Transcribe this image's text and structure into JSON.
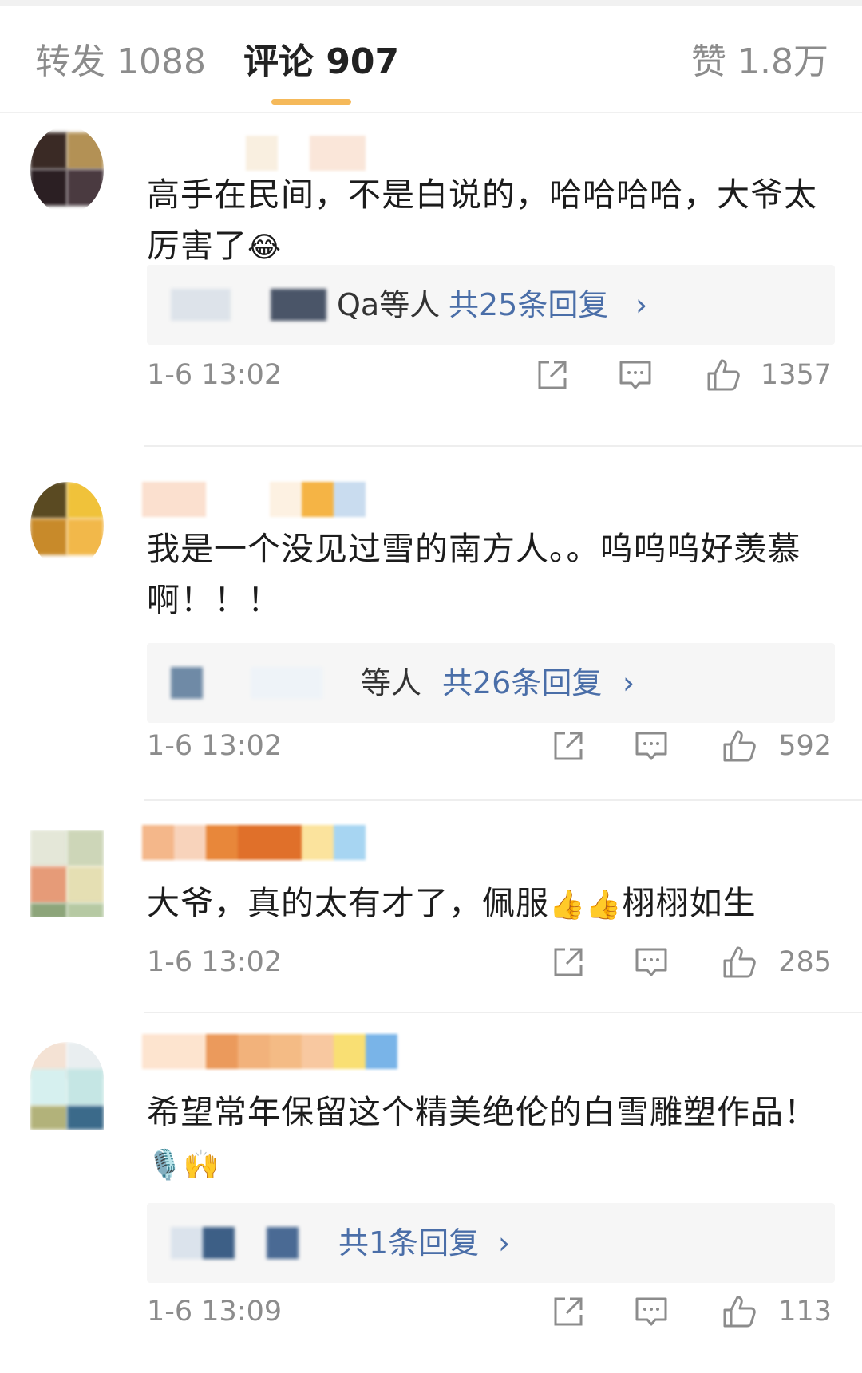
{
  "tabs": {
    "repost": "转发 1088",
    "comments": "评论 907",
    "likes": "赞 1.8万"
  },
  "comments": [
    {
      "text": "高手在民间，不是白说的，哈哈哈哈，大爷太厉害了",
      "emoji": "😂",
      "reply_who": "Qa等人",
      "reply_count": "共25条回复",
      "time": "1-6 13:02",
      "likes": "1357"
    },
    {
      "text": "我是一个没见过雪的南方人。。呜呜呜好羡慕啊！！！",
      "reply_who": "等人",
      "reply_count": "共26条回复",
      "time": "1-6 13:02",
      "likes": "592"
    },
    {
      "text": "大爷，真的太有才了，佩服",
      "emoji": "👍👍",
      "text_tail": "栩栩如生",
      "time": "1-6 13:02",
      "likes": "285"
    },
    {
      "text": "希望常年保留这个精美绝伦的白雪雕塑作品！",
      "emoji": "🎙️🙌",
      "reply_count": "共1条回复",
      "time": "1-6 13:09",
      "likes": "113"
    }
  ],
  "chevron": "›",
  "icons": [
    "share-icon",
    "comment-icon",
    "like-icon"
  ],
  "colors": {
    "accent_underline": "#f5b95a",
    "link": "#4a6ea8",
    "muted": "#8c8c8c"
  }
}
